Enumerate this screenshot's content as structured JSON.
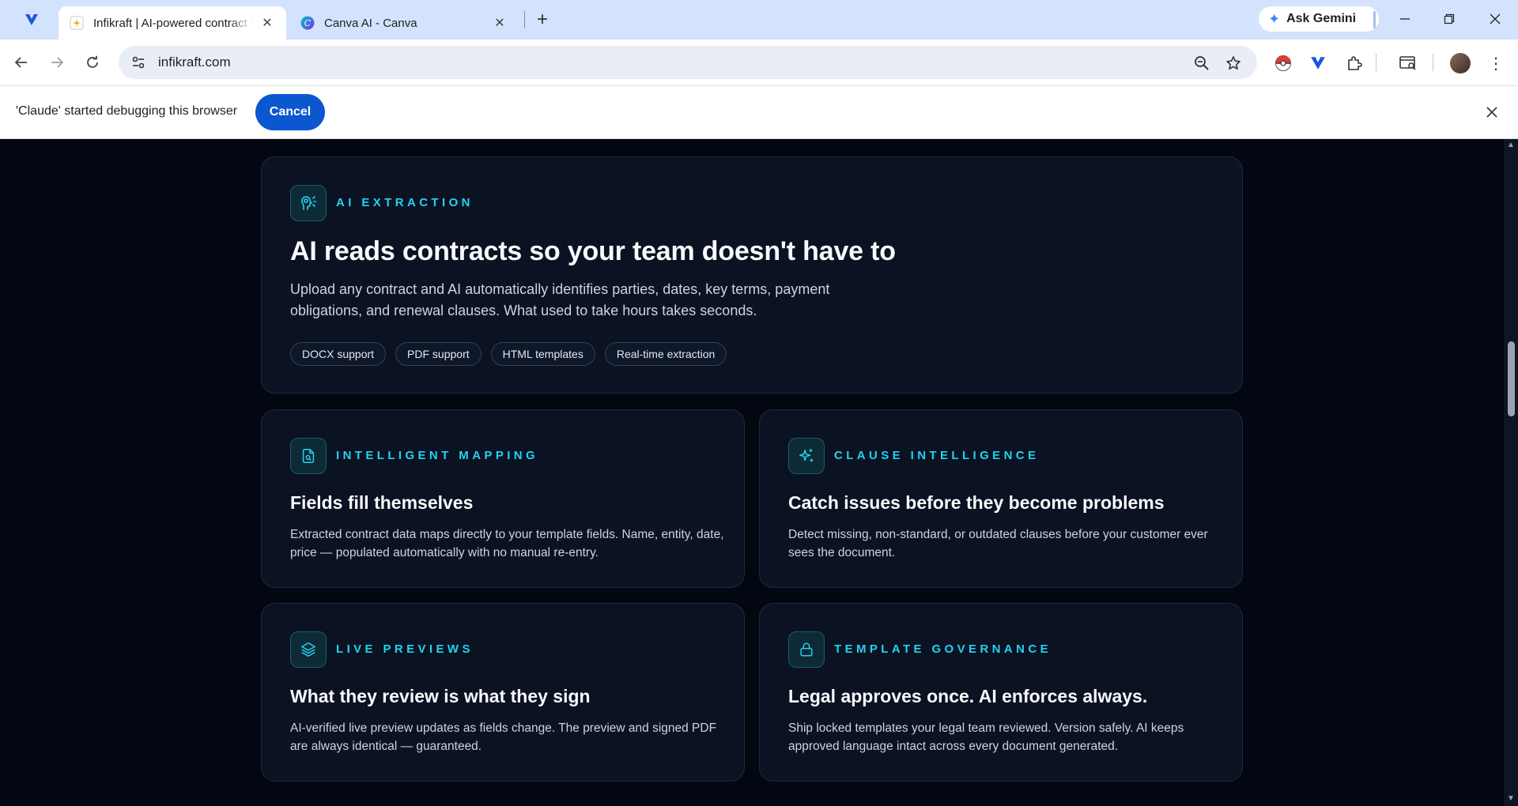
{
  "browser": {
    "tabs": [
      {
        "title": "Infikraft | AI-powered contract i",
        "active": true
      },
      {
        "title": "Canva AI - Canva",
        "active": false
      }
    ],
    "ask_gemini": "Ask Gemini",
    "url": "infikraft.com"
  },
  "infobar": {
    "message": "'Claude' started debugging this browser",
    "cancel_label": "Cancel"
  },
  "page": {
    "colors": {
      "accent": "#22d3ee",
      "background": "#030712",
      "card": "#0b1222"
    },
    "hero": {
      "eyebrow": "AI EXTRACTION",
      "title": "AI reads contracts so your team doesn't have to",
      "description": "Upload any contract and AI automatically identifies parties, dates, key terms, payment obligations, and renewal clauses. What used to take hours takes seconds.",
      "chips": [
        "DOCX support",
        "PDF support",
        "HTML templates",
        "Real-time extraction"
      ]
    },
    "features": [
      {
        "eyebrow": "INTELLIGENT MAPPING",
        "icon": "file-search-icon",
        "title": "Fields fill themselves",
        "description": "Extracted contract data maps directly to your template fields. Name, entity, date, price — populated automatically with no manual re-entry."
      },
      {
        "eyebrow": "CLAUSE INTELLIGENCE",
        "icon": "sparkles-icon",
        "title": "Catch issues before they become problems",
        "description": "Detect missing, non-standard, or outdated clauses before your customer ever sees the document."
      },
      {
        "eyebrow": "LIVE PREVIEWS",
        "icon": "layers-icon",
        "title": "What they review is what they sign",
        "description": "AI-verified live preview updates as fields change. The preview and signed PDF are always identical — guaranteed."
      },
      {
        "eyebrow": "TEMPLATE GOVERNANCE",
        "icon": "lock-icon",
        "title": "Legal approves once. AI enforces always.",
        "description": "Ship locked templates your legal team reviewed. Version safely. AI keeps approved language intact across every document generated."
      }
    ]
  }
}
